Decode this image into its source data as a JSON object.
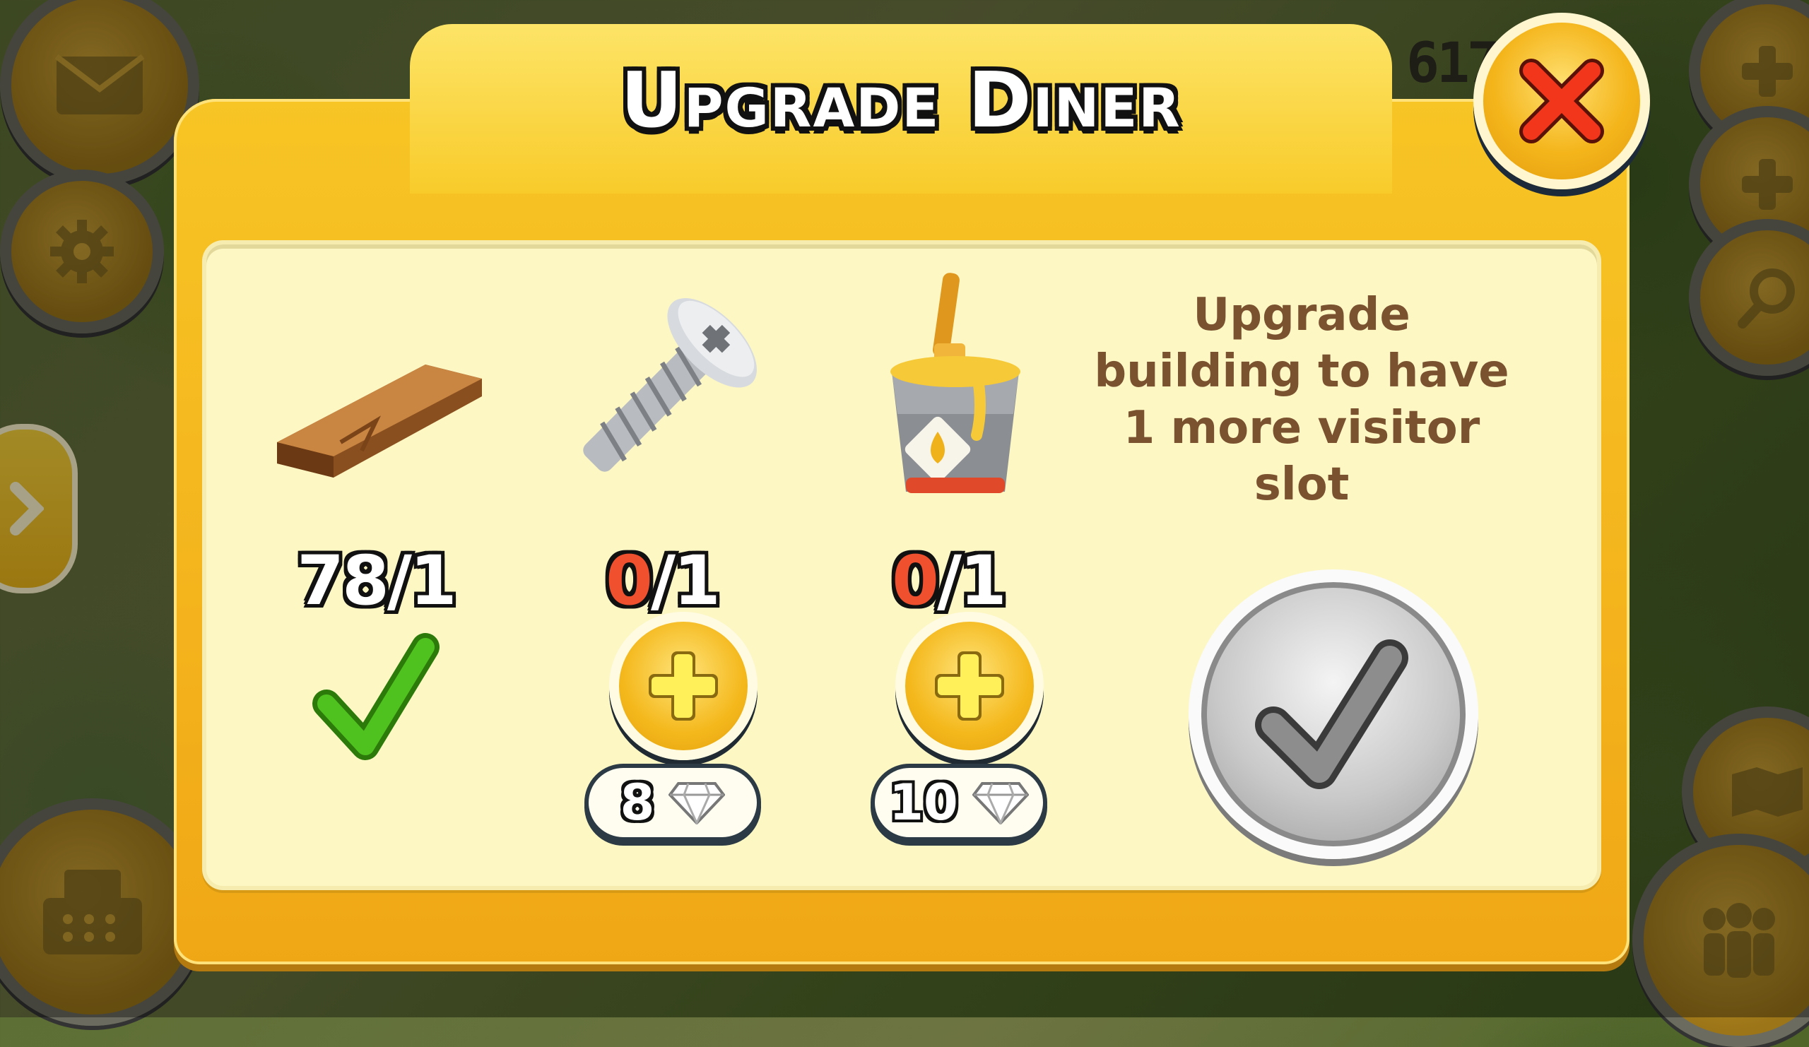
{
  "hud": {
    "coins": "617",
    "left_buttons": [
      "mail-icon",
      "gear-icon",
      "cash-register-icon"
    ],
    "right_buttons": [
      "plus-icon",
      "plus-icon",
      "magnifier-icon",
      "map-icon",
      "friends-icon"
    ]
  },
  "dialog": {
    "title": "Upgrade Diner",
    "description": "Upgrade building to have 1 more visitor slot",
    "items": [
      {
        "icon": "plank-icon",
        "have": "78",
        "need": "1",
        "missing": false
      },
      {
        "icon": "screw-icon",
        "have": "0",
        "need": "1",
        "missing": true,
        "price": "8",
        "currency_icon": "diamond-icon"
      },
      {
        "icon": "paint-bucket-icon",
        "have": "0",
        "need": "1",
        "missing": true,
        "price": "10",
        "currency_icon": "diamond-icon"
      }
    ],
    "confirm_state": "disabled"
  },
  "colors": {
    "dialog_yellow": "#f4b31c",
    "panel_cream": "#fdf7c4",
    "missing_red": "#f0502e",
    "check_green": "#3fae17",
    "desc_brown": "#7a5230"
  }
}
